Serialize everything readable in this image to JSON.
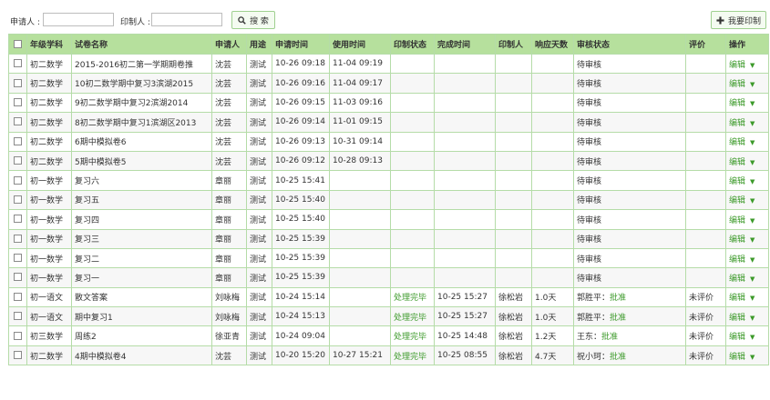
{
  "filters": {
    "applicant_label": "申请人 :",
    "printer_label": "印制人 :",
    "applicant_value": "",
    "printer_value": "",
    "search_label": "搜 索",
    "print_label": "我要印制"
  },
  "colors": {
    "header_bg": "#b6e09d",
    "border": "#b5dca8",
    "accent": "#3c9a2a"
  },
  "table": {
    "columns": [
      "年级学科",
      "试卷名称",
      "申请人",
      "用途",
      "申请时间",
      "使用时间",
      "印制状态",
      "完成时间",
      "印制人",
      "响应天数",
      "审核状态",
      "评价",
      "操作"
    ],
    "rows": [
      {
        "grade": "初二数学",
        "name": "2015-2016初二第一学期期卷推",
        "applicant": "沈芸",
        "usage": "测试",
        "apply_time": "10-26 09:18",
        "use_time": "11-04 09:19",
        "print_status": "",
        "finish_time": "",
        "printer": "",
        "days": "",
        "audit": "待审核",
        "audit_result": "",
        "rating": "",
        "op": "编辑"
      },
      {
        "grade": "初二数学",
        "name": "10初二数学期中复习3滨湖2015",
        "applicant": "沈芸",
        "usage": "测试",
        "apply_time": "10-26 09:16",
        "use_time": "11-04 09:17",
        "print_status": "",
        "finish_time": "",
        "printer": "",
        "days": "",
        "audit": "待审核",
        "audit_result": "",
        "rating": "",
        "op": "编辑"
      },
      {
        "grade": "初二数学",
        "name": "9初二数学期中复习2滨湖2014",
        "applicant": "沈芸",
        "usage": "测试",
        "apply_time": "10-26 09:15",
        "use_time": "11-03 09:16",
        "print_status": "",
        "finish_time": "",
        "printer": "",
        "days": "",
        "audit": "待审核",
        "audit_result": "",
        "rating": "",
        "op": "编辑"
      },
      {
        "grade": "初二数学",
        "name": "8初二数学期中复习1滨湖区2013",
        "applicant": "沈芸",
        "usage": "测试",
        "apply_time": "10-26 09:14",
        "use_time": "11-01 09:15",
        "print_status": "",
        "finish_time": "",
        "printer": "",
        "days": "",
        "audit": "待审核",
        "audit_result": "",
        "rating": "",
        "op": "编辑"
      },
      {
        "grade": "初二数学",
        "name": "6期中模拟卷6",
        "applicant": "沈芸",
        "usage": "测试",
        "apply_time": "10-26 09:13",
        "use_time": "10-31 09:14",
        "print_status": "",
        "finish_time": "",
        "printer": "",
        "days": "",
        "audit": "待审核",
        "audit_result": "",
        "rating": "",
        "op": "编辑"
      },
      {
        "grade": "初二数学",
        "name": "5期中模拟卷5",
        "applicant": "沈芸",
        "usage": "测试",
        "apply_time": "10-26 09:12",
        "use_time": "10-28 09:13",
        "print_status": "",
        "finish_time": "",
        "printer": "",
        "days": "",
        "audit": "待审核",
        "audit_result": "",
        "rating": "",
        "op": "编辑"
      },
      {
        "grade": "初一数学",
        "name": "复习六",
        "applicant": "章丽",
        "usage": "测试",
        "apply_time": "10-25 15:41",
        "use_time": "",
        "print_status": "",
        "finish_time": "",
        "printer": "",
        "days": "",
        "audit": "待审核",
        "audit_result": "",
        "rating": "",
        "op": "编辑"
      },
      {
        "grade": "初一数学",
        "name": "复习五",
        "applicant": "章丽",
        "usage": "测试",
        "apply_time": "10-25 15:40",
        "use_time": "",
        "print_status": "",
        "finish_time": "",
        "printer": "",
        "days": "",
        "audit": "待审核",
        "audit_result": "",
        "rating": "",
        "op": "编辑"
      },
      {
        "grade": "初一数学",
        "name": "复习四",
        "applicant": "章丽",
        "usage": "测试",
        "apply_time": "10-25 15:40",
        "use_time": "",
        "print_status": "",
        "finish_time": "",
        "printer": "",
        "days": "",
        "audit": "待审核",
        "audit_result": "",
        "rating": "",
        "op": "编辑"
      },
      {
        "grade": "初一数学",
        "name": "复习三",
        "applicant": "章丽",
        "usage": "测试",
        "apply_time": "10-25 15:39",
        "use_time": "",
        "print_status": "",
        "finish_time": "",
        "printer": "",
        "days": "",
        "audit": "待审核",
        "audit_result": "",
        "rating": "",
        "op": "编辑"
      },
      {
        "grade": "初一数学",
        "name": "复习二",
        "applicant": "章丽",
        "usage": "测试",
        "apply_time": "10-25 15:39",
        "use_time": "",
        "print_status": "",
        "finish_time": "",
        "printer": "",
        "days": "",
        "audit": "待审核",
        "audit_result": "",
        "rating": "",
        "op": "编辑"
      },
      {
        "grade": "初一数学",
        "name": "复习一",
        "applicant": "章丽",
        "usage": "测试",
        "apply_time": "10-25 15:39",
        "use_time": "",
        "print_status": "",
        "finish_time": "",
        "printer": "",
        "days": "",
        "audit": "待审核",
        "audit_result": "",
        "rating": "",
        "op": "编辑"
      },
      {
        "grade": "初一语文",
        "name": "散文答案",
        "applicant": "刘咏梅",
        "usage": "测试",
        "apply_time": "10-24 15:14",
        "use_time": "",
        "print_status": "处理完毕",
        "finish_time": "10-25 15:27",
        "printer": "徐松岩",
        "days": "1.0天",
        "audit": "郭胜平：",
        "audit_result": "批准",
        "rating": "未评价",
        "op": "编辑"
      },
      {
        "grade": "初一语文",
        "name": "期中复习1",
        "applicant": "刘咏梅",
        "usage": "测试",
        "apply_time": "10-24 15:13",
        "use_time": "",
        "print_status": "处理完毕",
        "finish_time": "10-25 15:27",
        "printer": "徐松岩",
        "days": "1.0天",
        "audit": "郭胜平：",
        "audit_result": "批准",
        "rating": "未评价",
        "op": "编辑"
      },
      {
        "grade": "初三数学",
        "name": "周练2",
        "applicant": "徐亚青",
        "usage": "测试",
        "apply_time": "10-24 09:04",
        "use_time": "",
        "print_status": "处理完毕",
        "finish_time": "10-25 14:48",
        "printer": "徐松岩",
        "days": "1.2天",
        "audit": "王东：",
        "audit_result": "批准",
        "rating": "未评价",
        "op": "编辑"
      },
      {
        "grade": "初二数学",
        "name": "4期中模拟卷4",
        "applicant": "沈芸",
        "usage": "测试",
        "apply_time": "10-20 15:20",
        "use_time": "10-27 15:21",
        "print_status": "处理完毕",
        "finish_time": "10-25 08:55",
        "printer": "徐松岩",
        "days": "4.7天",
        "audit": "祝小珂：",
        "audit_result": "批准",
        "rating": "未评价",
        "op": "编辑"
      }
    ]
  }
}
